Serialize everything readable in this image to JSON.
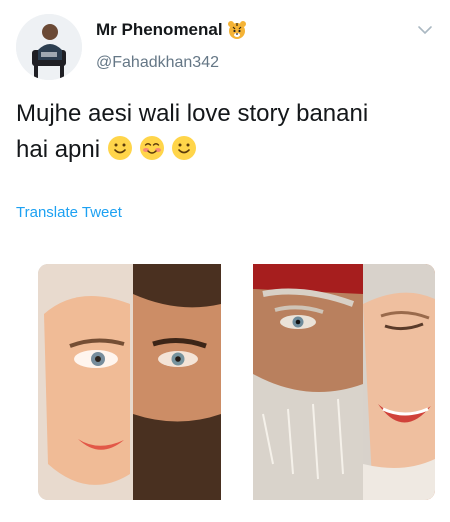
{
  "user": {
    "display_name": "Mr Phenomenal",
    "badge_emoji": "tiger-face",
    "handle": "@Fahadkhan342",
    "avatar": "avatar"
  },
  "header": {
    "menu_icon": "chevron-down-icon"
  },
  "tweet": {
    "text_line1": "Mujhe aesi wali love story banani",
    "text_line2": "hai apni",
    "emojis": [
      "slightly-smiling-face",
      "smiling-face-with-blush",
      "slightly-smiling-face"
    ],
    "translate_label": "Translate Tweet"
  },
  "media": [
    {
      "name": "young-couple-photo"
    },
    {
      "name": "elderly-couple-photo"
    }
  ],
  "colors": {
    "link": "#1da1f2",
    "text_primary": "#14171a",
    "text_secondary": "#657786",
    "emoji_yellow": "#ffd54a"
  }
}
